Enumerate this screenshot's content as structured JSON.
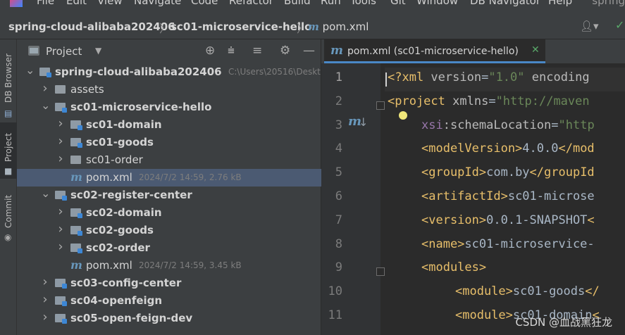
{
  "menubar": {
    "items": [
      "File",
      "Edit",
      "View",
      "Navigate",
      "Code",
      "Refactor",
      "Build",
      "Run",
      "Tools",
      "Git",
      "Window",
      "DB Navigator",
      "Help"
    ],
    "project_name": "spring"
  },
  "breadcrumb": {
    "items": [
      "spring-cloud-alibaba202406",
      "sc01-microservice-hello",
      "pom.xml"
    ],
    "separator": "〉"
  },
  "left_stripe": {
    "tabs": [
      "DB Browser",
      "Project",
      "Commit"
    ]
  },
  "project_panel": {
    "title": "Project",
    "tree": [
      {
        "label": "spring-cloud-alibaba202406",
        "meta": "C:\\Users\\20516\\Deskt",
        "depth": 0,
        "expanded": true,
        "icon": "module-folder",
        "bold": true
      },
      {
        "label": "assets",
        "meta": "",
        "depth": 1,
        "expanded": false,
        "icon": "folder",
        "bold": false
      },
      {
        "label": "sc01-microservice-hello",
        "meta": "",
        "depth": 1,
        "expanded": true,
        "icon": "module-folder",
        "bold": true
      },
      {
        "label": "sc01-domain",
        "meta": "",
        "depth": 2,
        "expanded": false,
        "icon": "module-folder",
        "bold": true
      },
      {
        "label": "sc01-goods",
        "meta": "",
        "depth": 2,
        "expanded": false,
        "icon": "module-folder",
        "bold": true
      },
      {
        "label": "sc01-order",
        "meta": "",
        "depth": 2,
        "expanded": false,
        "icon": "folder",
        "bold": false
      },
      {
        "label": "pom.xml",
        "meta": "2024/7/2 14:59, 2.76 kB",
        "depth": 2,
        "expanded": null,
        "icon": "maven-file",
        "bold": false,
        "selected": true
      },
      {
        "label": "sc02-register-center",
        "meta": "",
        "depth": 1,
        "expanded": true,
        "icon": "module-folder",
        "bold": true
      },
      {
        "label": "sc02-domain",
        "meta": "",
        "depth": 2,
        "expanded": false,
        "icon": "module-folder",
        "bold": true
      },
      {
        "label": "sc02-goods",
        "meta": "",
        "depth": 2,
        "expanded": false,
        "icon": "module-folder",
        "bold": true
      },
      {
        "label": "sc02-order",
        "meta": "",
        "depth": 2,
        "expanded": false,
        "icon": "module-folder",
        "bold": true
      },
      {
        "label": "pom.xml",
        "meta": "2024/7/2 14:59, 3.45 kB",
        "depth": 2,
        "expanded": null,
        "icon": "maven-file",
        "bold": false
      },
      {
        "label": "sc03-config-center",
        "meta": "",
        "depth": 1,
        "expanded": false,
        "icon": "module-folder",
        "bold": true
      },
      {
        "label": "sc04-openfeign",
        "meta": "",
        "depth": 1,
        "expanded": false,
        "icon": "module-folder",
        "bold": true
      },
      {
        "label": "sc05-open-feign-dev",
        "meta": "",
        "depth": 1,
        "expanded": false,
        "icon": "module-folder",
        "bold": true
      }
    ]
  },
  "editor": {
    "tab_label": "pom.xml (sc01-microservice-hello)",
    "lines": [
      {
        "no": "1",
        "indent": 0,
        "tokens": [
          [
            "tag",
            "<?xml "
          ],
          [
            "attr",
            "version"
          ],
          [
            "txt",
            "="
          ],
          [
            "str",
            "\"1.0\""
          ],
          [
            "attr",
            " encoding"
          ]
        ]
      },
      {
        "no": "2",
        "indent": 0,
        "tokens": [
          [
            "tag",
            "<project "
          ],
          [
            "attr",
            "xmlns"
          ],
          [
            "txt",
            "="
          ],
          [
            "str",
            "\"http://maven"
          ]
        ]
      },
      {
        "no": "3",
        "indent": 1,
        "tokens": [
          [
            "ns",
            "xsi"
          ],
          [
            "attr",
            ":schemaLocation"
          ],
          [
            "txt",
            "="
          ],
          [
            "str",
            "\"http"
          ]
        ]
      },
      {
        "no": "4",
        "indent": 1,
        "tokens": [
          [
            "tag",
            "<modelVersion>"
          ],
          [
            "txt",
            "4.0.0"
          ],
          [
            "tag",
            "</mod"
          ]
        ]
      },
      {
        "no": "5",
        "indent": 1,
        "tokens": [
          [
            "tag",
            "<groupId>"
          ],
          [
            "txt",
            "com.by"
          ],
          [
            "tag",
            "</groupId"
          ]
        ]
      },
      {
        "no": "6",
        "indent": 1,
        "tokens": [
          [
            "tag",
            "<artifactId>"
          ],
          [
            "txt",
            "sc01-microse"
          ]
        ]
      },
      {
        "no": "7",
        "indent": 1,
        "tokens": [
          [
            "tag",
            "<version>"
          ],
          [
            "txt",
            "0.0.1-SNAPSHOT"
          ],
          [
            "tag",
            "<"
          ]
        ]
      },
      {
        "no": "8",
        "indent": 1,
        "tokens": [
          [
            "tag",
            "<name>"
          ],
          [
            "txt",
            "sc01-microservice-"
          ]
        ]
      },
      {
        "no": "9",
        "indent": 1,
        "tokens": [
          [
            "tag",
            "<modules>"
          ]
        ]
      },
      {
        "no": "10",
        "indent": 2,
        "tokens": [
          [
            "tag",
            "<module>"
          ],
          [
            "txt",
            "sc01-goods"
          ],
          [
            "tag",
            "</"
          ]
        ]
      },
      {
        "no": "11",
        "indent": 2,
        "tokens": [
          [
            "tag",
            "<module>"
          ],
          [
            "txt",
            "sc01-domain"
          ],
          [
            "tag",
            "<"
          ]
        ]
      }
    ]
  },
  "watermark": "CSDN @血战黑狂龙"
}
